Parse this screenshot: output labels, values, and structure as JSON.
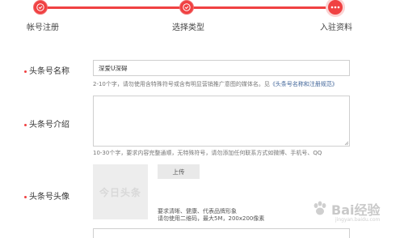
{
  "steps": [
    {
      "label": "帐号注册",
      "state": "done"
    },
    {
      "label": "选择类型",
      "state": "done"
    },
    {
      "label": "入驻资料",
      "state": "current"
    }
  ],
  "colors": {
    "accent": "#f04142",
    "link": "#406599",
    "border": "#cfcfcf"
  },
  "form": {
    "name": {
      "label": "头条号名称",
      "value": "深爱U深碍",
      "hint_prefix": "2-10个字，请勿使用含特殊符号或含有明显营销推广意图的媒体名。见",
      "hint_link": "《头条号名称和注册规范》"
    },
    "intro": {
      "label": "头条号介绍",
      "value": "",
      "hint": "10-30个字，要求内容完整通顺，无特殊符号，请勿添加任何联系方式如微博、手机号、QQ"
    },
    "avatar": {
      "label": "头条号头像",
      "placeholder_text": "今日头条",
      "upload_label": "上传",
      "req_line1": "要求清晰、健康、代表品牌形象",
      "req_line2": "请勿使用二维码，最大5M，200x200像素"
    }
  },
  "watermark": {
    "text": "Bai经验",
    "sub": "jingyan.baidu.com"
  }
}
